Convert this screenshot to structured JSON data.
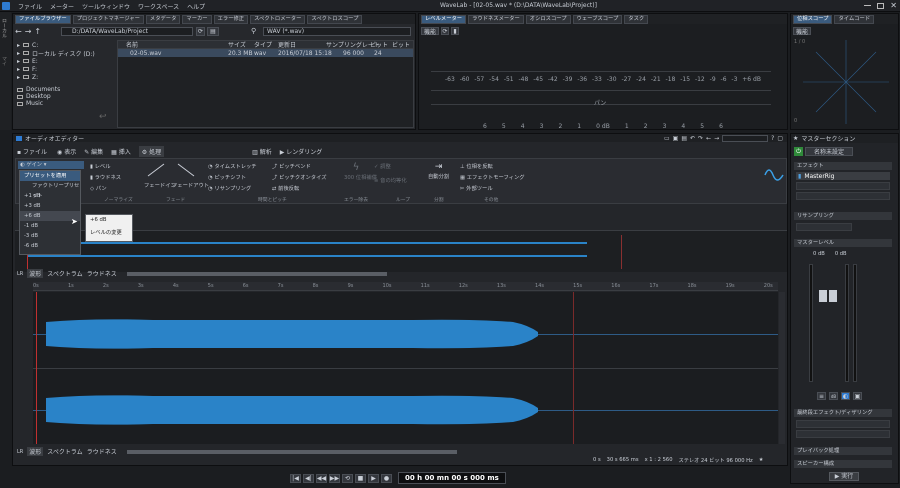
{
  "app": {
    "title": "WaveLab - [02-05.wav * (D:\\DATA\\WaveLab\\Project)]",
    "menus": [
      "ファイル",
      "メーター",
      "ツールウィンドウ",
      "ワークスペース",
      "ヘルプ"
    ]
  },
  "browser": {
    "tabs": [
      "ファイルブラウザー",
      "プロジェクトマネージャー",
      "メタデータ",
      "マーカー",
      "エラー修正",
      "スペクトロメーター",
      "スペクトロスコープ"
    ],
    "path": "D:/DATA/WaveLab/Project",
    "filter": "WAV (*.wav)",
    "tree": [
      "C:",
      "ローカル ディスク (D:)",
      "E:",
      "F:",
      "Z:"
    ],
    "places": [
      "Documents",
      "Desktop",
      "Music"
    ],
    "columns": [
      "名前",
      "サイズ",
      "タイプ",
      "更新日",
      "サンプリングレート",
      "ビット",
      "ビット"
    ],
    "files": [
      {
        "name": "02-05.wav",
        "size": "20.3 MB",
        "type": "wav",
        "date": "2016/07/18 15:18",
        "rate": "96 000",
        "bits": "24"
      }
    ],
    "side_labels": [
      "ローカル",
      "マイ"
    ]
  },
  "meter": {
    "tabs": [
      "レベルメーター",
      "ラウドネスメーター",
      "オシロスコープ",
      "ウェーブスコープ",
      "タスク"
    ],
    "settings": "機能",
    "scale": [
      "-63",
      "-60",
      "-57",
      "-54",
      "-51",
      "-48",
      "-45",
      "-42",
      "-39",
      "-36",
      "-33",
      "-30",
      "-27",
      "-24",
      "-21",
      "-18",
      "-15",
      "-12",
      "-9",
      "-6",
      "-3",
      "+6 dB"
    ],
    "pan_label": "パン",
    "pan_scale": [
      "6",
      "5",
      "4",
      "3",
      "2",
      "1",
      "0 dB",
      "1",
      "2",
      "3",
      "4",
      "5",
      "6"
    ]
  },
  "phase": {
    "tabs": [
      "位相スコープ",
      "タイムコード"
    ],
    "settings": "機能",
    "y_top": "1 / 0",
    "y_bottom": "0"
  },
  "master": {
    "title": "マスターセクション",
    "preset_label": "名称未設定",
    "effects": "エフェクト",
    "plugin": "MasterRig",
    "resampling": "リサンプリング",
    "level": "マスターレベル",
    "level_vals": [
      "0 dB",
      "0 dB"
    ],
    "final": "最終段エフェクト/ディザリング",
    "playback": "プレイバック処理",
    "speaker": "スピーカー構成",
    "render": "実行"
  },
  "editor": {
    "title": "オーディオエディター",
    "tabs": [
      "ファイル",
      "表示",
      "編集",
      "挿入",
      "処理",
      "解析",
      "レンダリング"
    ],
    "ribbon": {
      "gain": "ゲイン",
      "level": "レベル",
      "loudness": "ラウドネス",
      "pan": "パン",
      "fadein": "フェードイン",
      "fadeout": "フェードアウト",
      "timestretch": "タイムストレッチ",
      "pitchshift": "ピッチシフト",
      "resample": "リサンプリング",
      "pitchbend": "ピッチベンド",
      "pitchquant": "ピッチクオンタイズ",
      "reverse": "前後反転",
      "noise_reduce": "300 位相補償",
      "declick": "調整",
      "normalize": "音の均等化",
      "split": "自動分割",
      "phase_invert": "位相を反転",
      "envelope": "エフェクトモーフィング",
      "external": "外部ツール",
      "groups": [
        "ノーマライズ",
        "フェード",
        "時間とピッチ",
        "エラー除去",
        "ループ",
        "分割",
        "その他"
      ]
    },
    "gain_menu": {
      "apply": "プリセットを適用",
      "factory": "ファクトリープリセット",
      "items": [
        "+1 dB",
        "+3 dB",
        "+6 dB",
        "-1 dB",
        "-3 dB",
        "-6 dB"
      ]
    },
    "submenu": {
      "value": "+6 dB",
      "change": "レベルの変更"
    },
    "overview_tabs": [
      "波形",
      "スペクトラム",
      "ラウドネス"
    ],
    "ruler": [
      "0s",
      "1s",
      "2s",
      "3s",
      "4s",
      "5s",
      "6s",
      "7s",
      "8s",
      "9s",
      "10s",
      "11s",
      "12s",
      "13s",
      "14s",
      "15s",
      "16s",
      "17s",
      "18s",
      "19s",
      "20s"
    ],
    "status": {
      "pos": "0 s",
      "dur": "30 s 665 ms",
      "zoom": "x 1 : 2 560",
      "format": "ステレオ 24 ビット 96 000 Hz"
    },
    "transport": {
      "time": "00 h 00 mn 00 s 000 ms"
    }
  },
  "colors": {
    "wave": "#2a83c8",
    "accent": "#3a5b7e",
    "cursor": "#c03030"
  }
}
